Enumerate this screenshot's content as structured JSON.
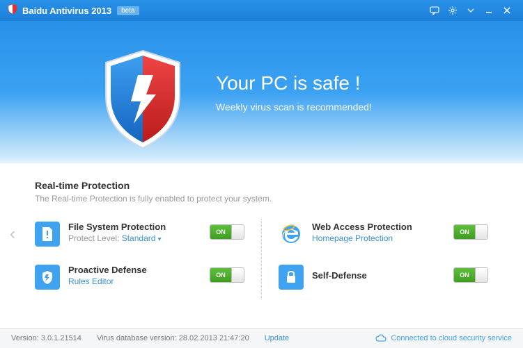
{
  "titlebar": {
    "app_name": "Baidu Antivirus 2013",
    "badge": "beta"
  },
  "hero": {
    "headline": "Your PC is safe !",
    "subline": "Weekly virus scan is recommended!"
  },
  "panel": {
    "section_title": "Real-time Protection",
    "section_desc": "The Real-time Protection is fully enabled to protect your system.",
    "items": [
      {
        "name": "File System Protection",
        "sub_label": "Protect Level:",
        "sub_link": "Standard",
        "toggle": "ON"
      },
      {
        "name": "Proactive Defense",
        "link": "Rules Editor",
        "toggle": "ON"
      },
      {
        "name": "Web Access Protection",
        "link": "Homepage Protection",
        "toggle": "ON"
      },
      {
        "name": "Self-Defense",
        "toggle": "ON"
      }
    ]
  },
  "statusbar": {
    "version_label": "Version:",
    "version": "3.0.1.21514",
    "db_label": "Virus database version:",
    "db_version": "28.02.2013 21:47:20",
    "update": "Update",
    "cloud": "Connected to cloud security service"
  }
}
